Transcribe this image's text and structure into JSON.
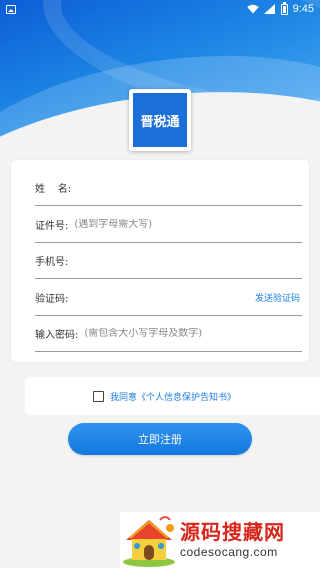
{
  "status_bar": {
    "time": "9:45"
  },
  "logo": {
    "text": "晋税通"
  },
  "form": {
    "name": {
      "label": "姓    名:",
      "placeholder": ""
    },
    "id_number": {
      "label": "证件号:",
      "placeholder": "(遇到字母需大写)"
    },
    "phone": {
      "label": "手机号:",
      "placeholder": ""
    },
    "code": {
      "label": "验证码:",
      "placeholder": "",
      "send_label": "发送验证码"
    },
    "password": {
      "label": "输入密码:",
      "placeholder": "(需包含大小写字母及数字)"
    }
  },
  "agreement": {
    "text": "我同意《个人信息保护告知书》"
  },
  "register_button": {
    "label": "立即注册"
  },
  "watermark": {
    "title": "源码搜藏网",
    "url": "codesocang.com"
  },
  "colors": {
    "primary": "#1e7ee0",
    "header_dark": "#0d5dd6",
    "watermark_red": "#d9261c"
  }
}
